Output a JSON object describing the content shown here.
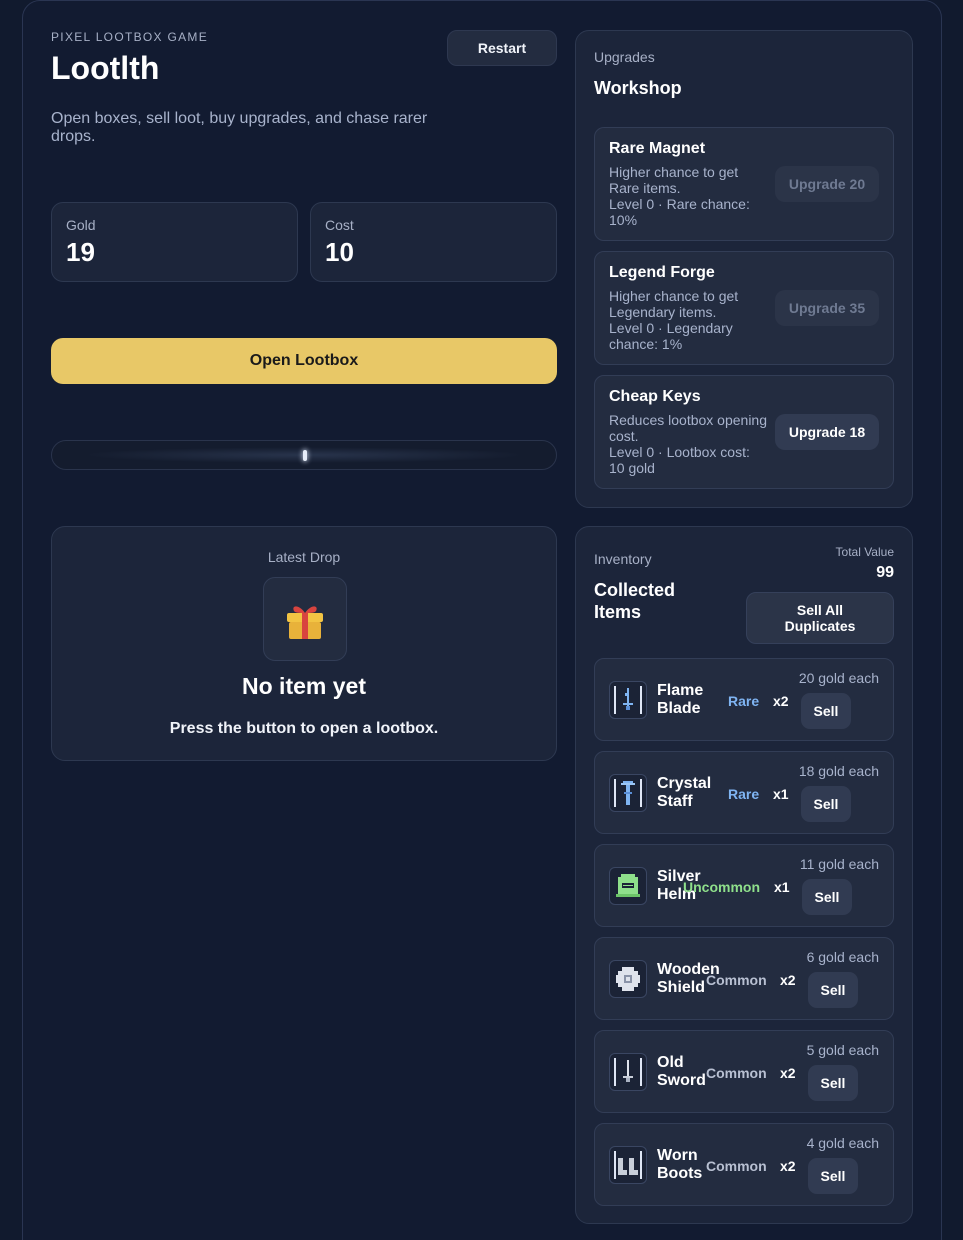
{
  "header": {
    "eyebrow": "PIXEL LOOTBOX GAME",
    "title": "Lootlth",
    "subtitle": "Open boxes, sell loot, buy upgrades, and chase rarer drops.",
    "restart_label": "Restart"
  },
  "stats": {
    "gold_label": "Gold",
    "gold_value": "19",
    "cost_label": "Cost",
    "cost_value": "10"
  },
  "open_button_label": "Open Lootbox",
  "latest_drop": {
    "label": "Latest Drop",
    "name": "No item yet",
    "hint": "Press the button to open a lootbox."
  },
  "workshop": {
    "eyebrow": "Upgrades",
    "title": "Workshop",
    "upgrades": [
      {
        "name": "Rare Magnet",
        "description": "Higher chance to get Rare items.",
        "status": "Level 0 · Rare chance: 10%",
        "button": "Upgrade 20"
      },
      {
        "name": "Legend Forge",
        "description": "Higher chance to get Legendary items.",
        "status": "Level 0 · Legendary chance: 1%",
        "button": "Upgrade 35"
      },
      {
        "name": "Cheap Keys",
        "description": "Reduces lootbox opening cost.",
        "status": "Level 0 · Lootbox cost: 10 gold",
        "button": "Upgrade 18"
      }
    ]
  },
  "inventory": {
    "eyebrow": "Inventory",
    "title": "Collected Items",
    "total_label": "Total Value",
    "total_value": "99",
    "sell_all_label": "Sell All Duplicates",
    "items": [
      {
        "name": "Flame Blade",
        "rarity": "Rare",
        "qty": "x2",
        "price": "20 gold each",
        "sell": "Sell",
        "icon": "flame-blade-icon"
      },
      {
        "name": "Crystal Staff",
        "rarity": "Rare",
        "qty": "x1",
        "price": "18 gold each",
        "sell": "Sell",
        "icon": "crystal-staff-icon"
      },
      {
        "name": "Silver Helm",
        "rarity": "Uncommon",
        "qty": "x1",
        "price": "11 gold each",
        "sell": "Sell",
        "icon": "silver-helm-icon"
      },
      {
        "name": "Wooden Shield",
        "rarity": "Common",
        "qty": "x2",
        "price": "6 gold each",
        "sell": "Sell",
        "icon": "wooden-shield-icon"
      },
      {
        "name": "Old Sword",
        "rarity": "Common",
        "qty": "x2",
        "price": "5 gold each",
        "sell": "Sell",
        "icon": "old-sword-icon"
      },
      {
        "name": "Worn Boots",
        "rarity": "Common",
        "qty": "x2",
        "price": "4 gold each",
        "sell": "Sell",
        "icon": "worn-boots-icon"
      }
    ]
  },
  "colors": {
    "accent_button": "#e8c867",
    "rare": "#7fb4f2",
    "uncommon": "#8fe08b",
    "common": "#b8c0d2"
  }
}
